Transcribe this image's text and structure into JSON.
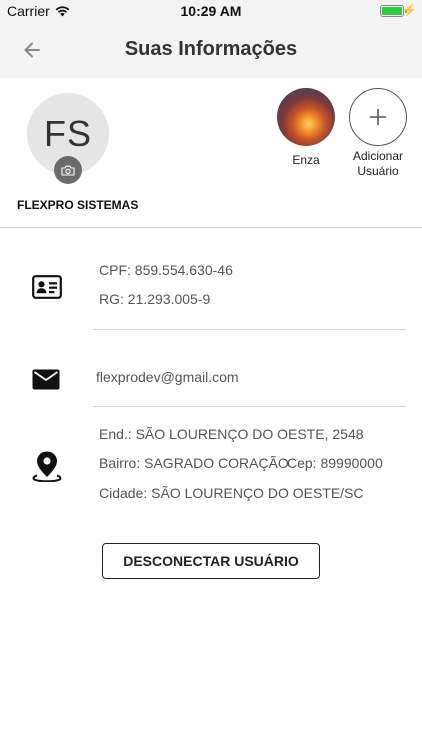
{
  "status_bar": {
    "carrier": "Carrier",
    "time": "10:29 AM",
    "battery_level": 1.0
  },
  "header": {
    "title": "Suas Informações",
    "back_icon": "arrow-left-icon"
  },
  "profile": {
    "initials": "FS",
    "name": "FLEXPRO SISTEMAS",
    "camera_icon": "camera-icon"
  },
  "users": [
    {
      "label": "Enza"
    }
  ],
  "add_user": {
    "label_line1": "Adicionar",
    "label_line2": "Usuário"
  },
  "documents": {
    "icon": "id-card-icon",
    "cpf": "CPF: 859.554.630-46",
    "rg": "RG: 21.293.005-9"
  },
  "email": {
    "icon": "envelope-icon",
    "value": "flexprodev@gmail.com"
  },
  "address": {
    "icon": "location-pin-icon",
    "street": "End.: SÃO LOURENÇO DO OESTE, 2548",
    "district": "Bairro: SAGRADO CORAÇÃO",
    "cep": "Cep: 89990000",
    "city": "Cidade: SÃO LOURENÇO DO OESTE/SC"
  },
  "logout_label": "DESCONECTAR USUÁRIO",
  "colors": {
    "header_bg": "#f3f3f3",
    "avatar_bg": "#e6e6e6",
    "battery": "#2ecc40",
    "text_secondary": "#555555"
  }
}
